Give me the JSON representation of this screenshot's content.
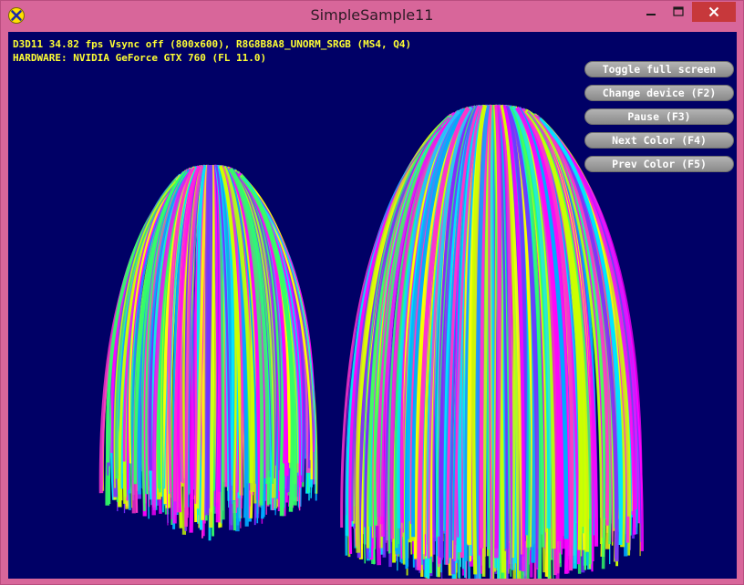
{
  "window": {
    "title": "SimpleSample11",
    "icon": "dx-app-icon",
    "controls": [
      "minimize-icon",
      "maximize-icon",
      "close-icon"
    ]
  },
  "stats": {
    "line1": "D3D11 34.82 fps Vsync off (800x600), R8G8B8A8_UNORM_SRGB (MS4, Q4)",
    "line2": "HARDWARE: NVIDIA GeForce GTX 760 (FL 11.0)"
  },
  "buttons": {
    "fullscreen": "Toggle full screen",
    "device": "Change device (F2)",
    "pause": "Pause (F3)",
    "next_color": "Next Color (F4)",
    "prev_color": "Prev Color (F5)"
  },
  "colors": {
    "frame": "#d8669a",
    "viewport_bg": "#000066",
    "stats_text": "#ffff33",
    "hair_palette": [
      "#00e5ff",
      "#ff00ff",
      "#ffff00",
      "#7a2cff",
      "#33ff66",
      "#00aaff",
      "#ff33cc",
      "#ccff00"
    ]
  }
}
